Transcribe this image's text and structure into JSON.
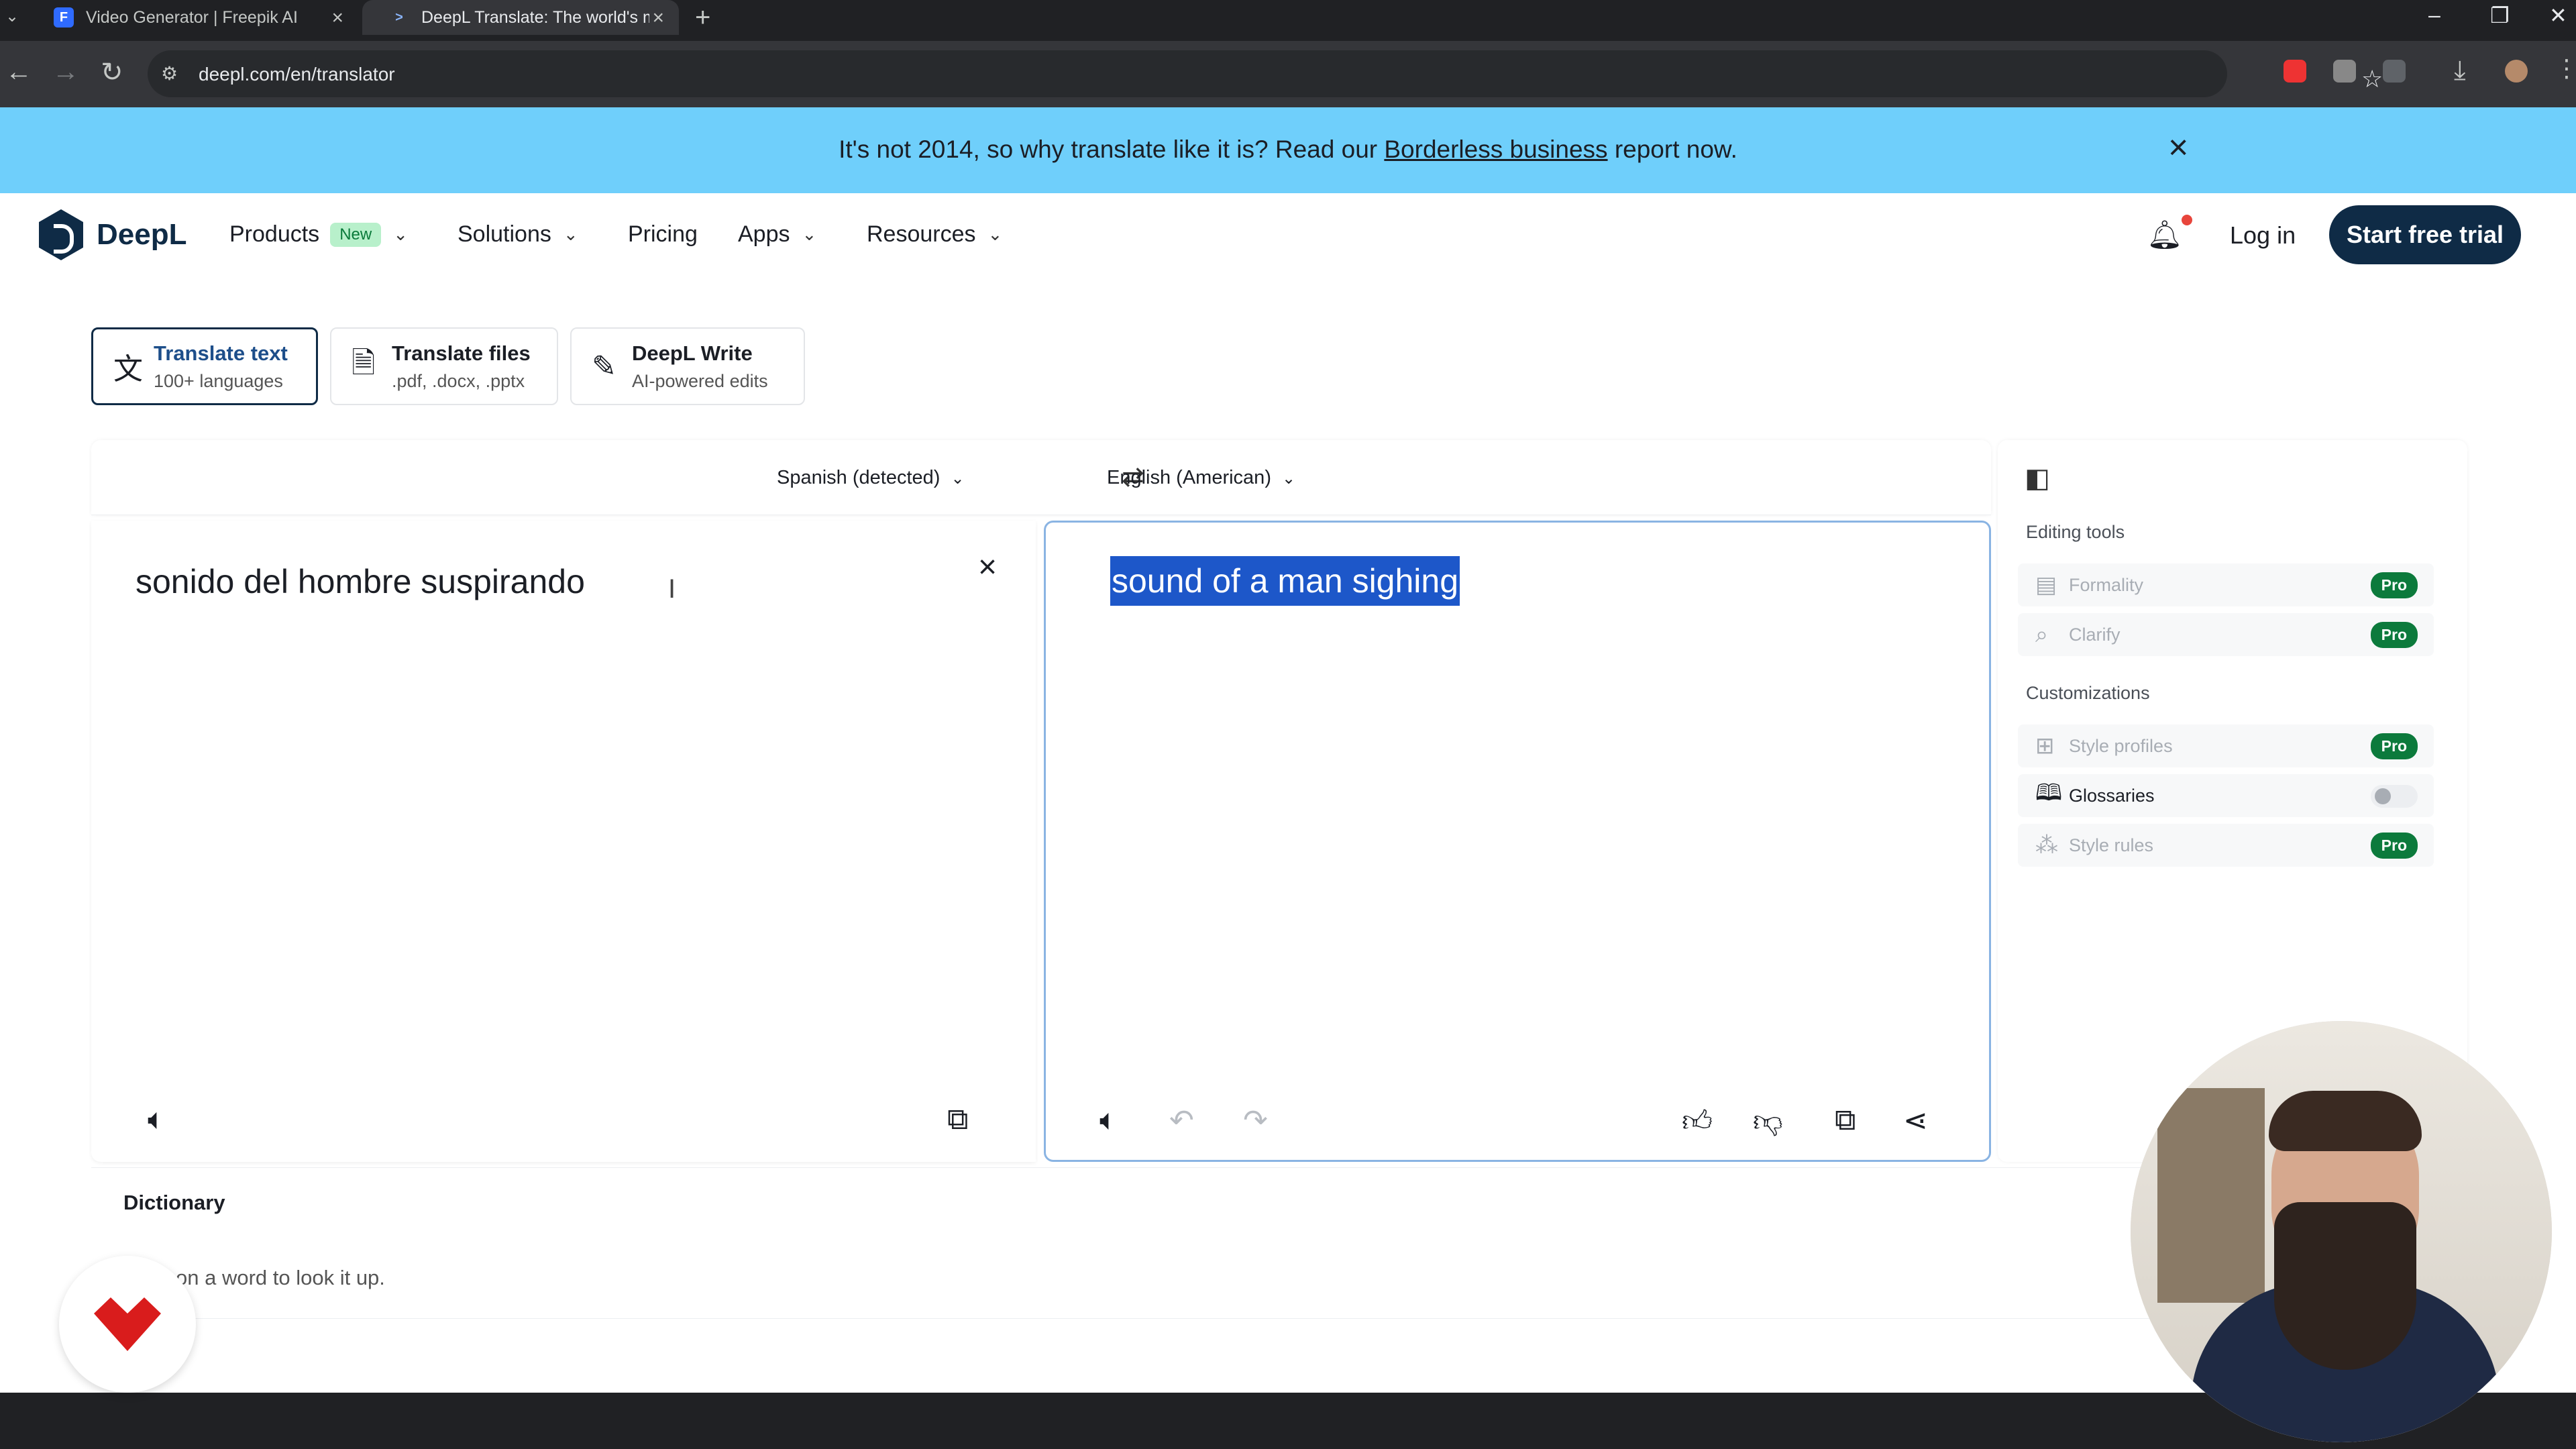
{
  "browser": {
    "tabs": [
      {
        "title": "Video Generator | Freepik AI",
        "favicon": "freepik-icon",
        "active": false
      },
      {
        "title": "DeepL Translate: The world's m",
        "favicon": "deepl-icon",
        "active": true
      }
    ],
    "url": "deepl.com/en/translator"
  },
  "banner": {
    "text_before": "It's not 2014, so why translate like it is? Read our ",
    "link": "Borderless business",
    "text_after": " report now."
  },
  "header": {
    "logo": "DeepL",
    "nav": [
      {
        "label": "Products",
        "badge": "New",
        "dropdown": true
      },
      {
        "label": "Solutions",
        "dropdown": true
      },
      {
        "label": "Pricing",
        "dropdown": false
      },
      {
        "label": "Apps",
        "dropdown": true
      },
      {
        "label": "Resources",
        "dropdown": true
      }
    ],
    "login": "Log in",
    "cta": "Start free trial"
  },
  "modes": [
    {
      "title": "Translate text",
      "subtitle": "100+ languages",
      "icon": "translate-icon",
      "active": true
    },
    {
      "title": "Translate files",
      "subtitle": ".pdf, .docx, .pptx",
      "icon": "file-icon",
      "active": false
    },
    {
      "title": "DeepL Write",
      "subtitle": "AI-powered edits",
      "icon": "magic-pen-icon",
      "active": false
    }
  ],
  "translator": {
    "source_lang": "Spanish (detected)",
    "target_lang": "English (American)",
    "source_text": "sonido del hombre suspirando",
    "target_text": "sound of a man sighing",
    "target_selected": true
  },
  "side_panel": {
    "editing_tools_heading": "Editing tools",
    "editing_tools": [
      {
        "label": "Formality",
        "badge": "Pro"
      },
      {
        "label": "Clarify",
        "badge": "Pro"
      }
    ],
    "customizations_heading": "Customizations",
    "customizations": [
      {
        "label": "Style profiles",
        "badge": "Pro",
        "enabled": false
      },
      {
        "label": "Glossaries",
        "toggle": "off",
        "enabled": true
      },
      {
        "label": "Style rules",
        "badge": "Pro",
        "enabled": false
      }
    ]
  },
  "dictionary": {
    "title": "Dictionary",
    "hint": "on a word to look it up."
  },
  "colors": {
    "banner": "#6fcffb",
    "brand": "#0f2b46",
    "selection": "#1d57c9",
    "pro_badge": "#0c7a3c"
  }
}
